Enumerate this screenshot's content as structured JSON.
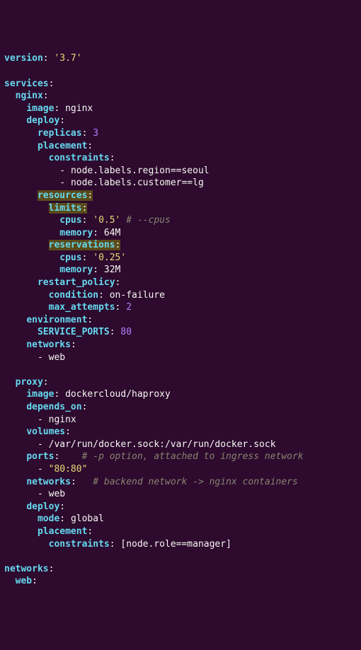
{
  "yaml": {
    "version_key": "version",
    "version_val": "'3.7'",
    "services_key": "services",
    "nginx_key": "nginx",
    "image_key": "image",
    "nginx_image": "nginx",
    "deploy_key": "deploy",
    "replicas_key": "replicas",
    "replicas_val": "3",
    "placement_key": "placement",
    "constraints_key": "constraints",
    "constraint1": "node.labels.region==seoul",
    "constraint2": "node.labels.customer==lg",
    "resources_key": "resources",
    "limits_key": "limits",
    "cpus_key": "cpus",
    "cpus_limit": "'0.5'",
    "cpus_comment": "# --cpus",
    "memory_key": "memory",
    "mem_limit": "64M",
    "reservations_key": "reservations",
    "cpus_res": "'0.25'",
    "mem_res": "32M",
    "restart_key": "restart_policy",
    "condition_key": "condition",
    "condition_val": "on-failure",
    "max_attempts_key": "max_attempts",
    "max_attempts_val": "2",
    "env_key": "environment",
    "svc_ports_key": "SERVICE_PORTS",
    "svc_ports_val": "80",
    "networks_key": "networks",
    "web_item": "web",
    "proxy_key": "proxy",
    "proxy_image": "dockercloud/haproxy",
    "depends_key": "depends_on",
    "nginx_item": "nginx",
    "volumes_key": "volumes",
    "volume_item": "/var/run/docker.sock:/var/run/docker.sock",
    "ports_key": "ports",
    "ports_comment": "# -p option, attached to ingress network",
    "port_item": "\"80:80\"",
    "nets_comment": "# backend network -> nginx containers",
    "mode_key": "mode",
    "mode_val": "global",
    "constraints_inline": "[node.role==manager]",
    "web_key": "web"
  }
}
